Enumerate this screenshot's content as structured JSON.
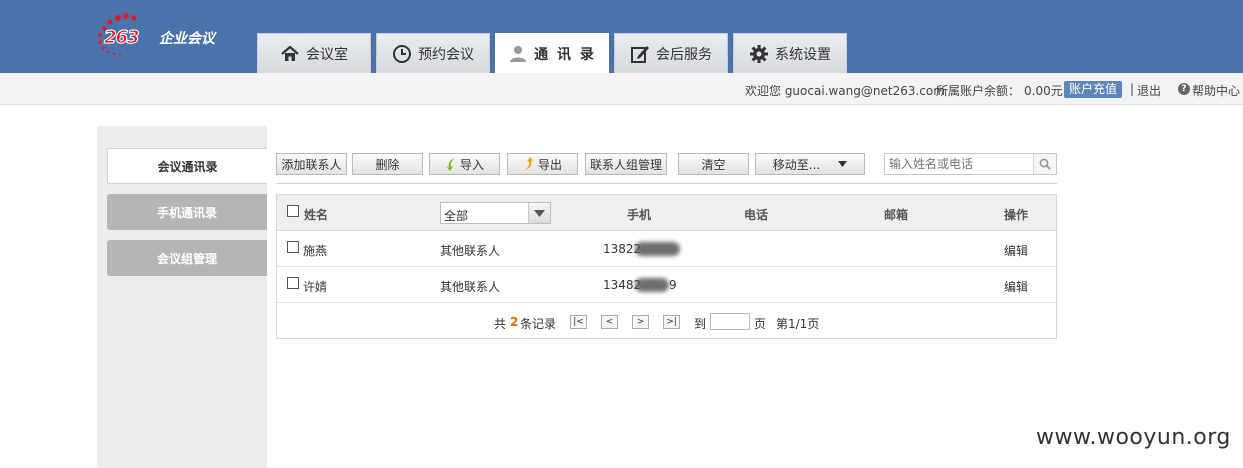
{
  "brand": {
    "logo_number": "263",
    "logo_text": "企业会议"
  },
  "nav": {
    "tabs": [
      {
        "label": "会议室",
        "icon": "home-icon"
      },
      {
        "label": "预约会议",
        "icon": "clock-icon"
      },
      {
        "label": "通 讯 录",
        "icon": "user-icon",
        "active": true
      },
      {
        "label": "会后服务",
        "icon": "edit-icon"
      },
      {
        "label": "系统设置",
        "icon": "gear-icon"
      }
    ]
  },
  "infobar": {
    "welcome": "欢迎您 guocai.wang@net263.com",
    "balance_label": "所属账户余额：",
    "balance_value": "0.00元",
    "recharge_label": "账户充值",
    "sep": "|",
    "logout_label": "退出",
    "help_label": "帮助中心"
  },
  "sidebar": {
    "items": [
      {
        "label": "会议通讯录",
        "active": true
      },
      {
        "label": "手机通讯录"
      },
      {
        "label": "会议组管理"
      }
    ]
  },
  "toolbar": {
    "add_label": "添加联系人",
    "delete_label": "删除",
    "import_label": "导入",
    "export_label": "导出",
    "groups_label": "联系人组管理",
    "clear_label": "清空",
    "move_label": "移动至...",
    "search_placeholder": "输入姓名或电话"
  },
  "table": {
    "headers": {
      "name": "姓名",
      "group_filter": "全部",
      "mobile": "手机",
      "phone": "电话",
      "email": "邮箱",
      "action": "操作"
    },
    "rows": [
      {
        "name": "施燕",
        "group": "其他联系人",
        "mobile": "13822",
        "action": "编辑"
      },
      {
        "name": "许婧",
        "group": "其他联系人",
        "mobile": "13482",
        "mobile_tail": "9",
        "action": "编辑"
      }
    ]
  },
  "pager": {
    "total_prefix": "共",
    "total_count": "2",
    "total_suffix": "条记录",
    "first": "|<",
    "prev": "<",
    "next": ">",
    "last": ">|",
    "goto_label": "到",
    "page_unit": "页",
    "page_status": "第1/1页"
  },
  "watermark": "www.wooyun.org",
  "colors": {
    "header_bg": "#4a72ab",
    "accent_link": "#1e5fad",
    "count_orange": "#e07000"
  }
}
